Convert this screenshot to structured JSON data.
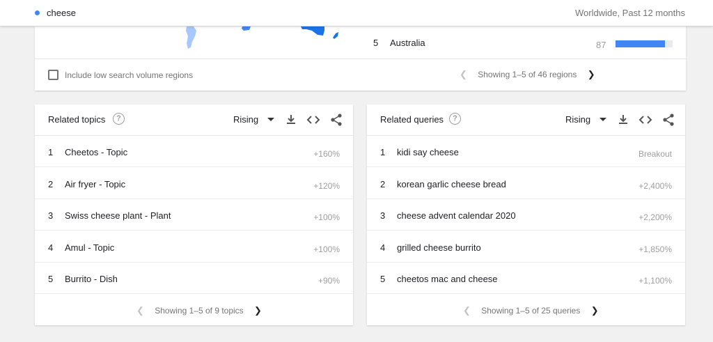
{
  "header": {
    "search_term": "cheese",
    "scope": "Worldwide, Past 12 months",
    "term_color": "#4285f4"
  },
  "region_card": {
    "top_region": {
      "rank": "5",
      "name": "Australia",
      "value": "87",
      "fill_fraction": 0.87
    },
    "low_volume_label": "Include low search volume regions",
    "pagination": "Showing 1–5 of 46 regions"
  },
  "related_topics": {
    "title": "Related topics",
    "help_icon": "help-icon",
    "filter": "Rising",
    "rows": [
      {
        "rank": "1",
        "label": "Cheetos - Topic",
        "value": "+160%"
      },
      {
        "rank": "2",
        "label": "Air fryer - Topic",
        "value": "+120%"
      },
      {
        "rank": "3",
        "label": "Swiss cheese plant - Plant",
        "value": "+100%"
      },
      {
        "rank": "4",
        "label": "Amul - Topic",
        "value": "+100%"
      },
      {
        "rank": "5",
        "label": "Burrito - Dish",
        "value": "+90%"
      }
    ],
    "pagination": "Showing 1–5 of 9 topics"
  },
  "related_queries": {
    "title": "Related queries",
    "help_icon": "help-icon",
    "filter": "Rising",
    "rows": [
      {
        "rank": "1",
        "label": "kidi say cheese",
        "value": "Breakout"
      },
      {
        "rank": "2",
        "label": "korean garlic cheese bread",
        "value": "+2,400%"
      },
      {
        "rank": "3",
        "label": "cheese advent calendar 2020",
        "value": "+2,200%"
      },
      {
        "rank": "4",
        "label": "grilled cheese burrito",
        "value": "+1,850%"
      },
      {
        "rank": "5",
        "label": "cheetos mac and cheese",
        "value": "+1,100%"
      }
    ],
    "pagination": "Showing 1–5 of 25 queries"
  },
  "colors": {
    "accent": "#4285f4",
    "map_light": "#a8c7fa",
    "map_dark": "#1a73e8"
  }
}
